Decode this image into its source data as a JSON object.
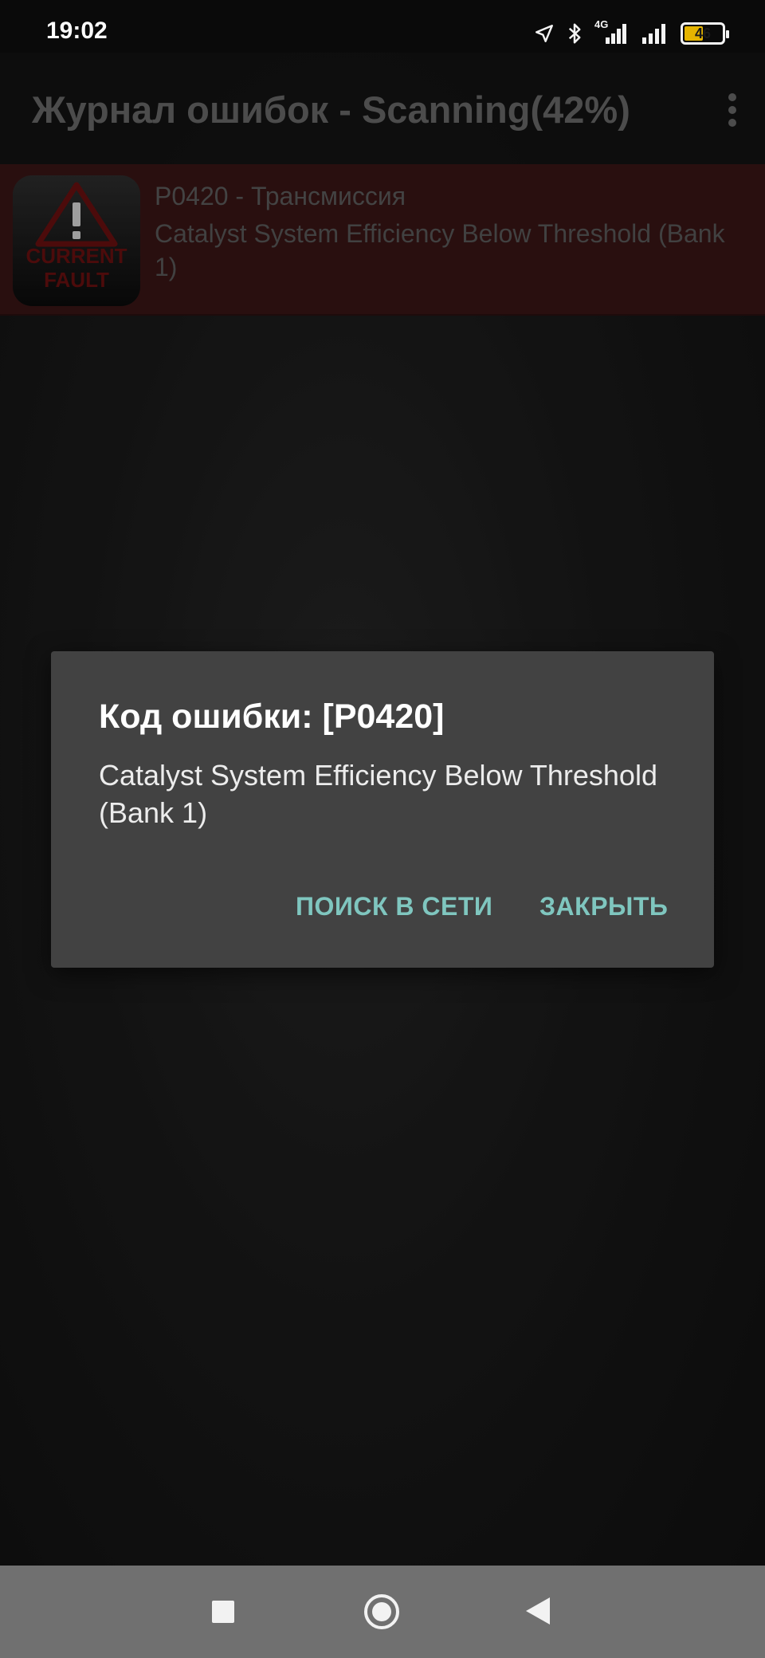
{
  "status_bar": {
    "time": "19:02",
    "network_label": "4G",
    "battery_level": "46",
    "icons": [
      "location-arrow-icon",
      "bluetooth-icon",
      "signal-4g-icon",
      "signal-icon",
      "battery-icon"
    ]
  },
  "app_bar": {
    "title": "Журнал ошибок - Scanning(42%)",
    "overflow_icon": "more-vert-icon"
  },
  "fault_list": [
    {
      "icon": "current-fault-icon",
      "icon_text": "CURRENT\nFAULT",
      "code": "P0420 - Трансмиссия",
      "description": "Catalyst System Efficiency Below Threshold (Bank 1)"
    }
  ],
  "dialog": {
    "title": "Код ошибки: [P0420]",
    "message": "Catalyst System Efficiency Below Threshold (Bank 1)",
    "buttons": {
      "search": "ПОИСК В СЕТИ",
      "close": "ЗАКРЫТЬ"
    }
  },
  "nav_bar": {
    "icons": [
      "recent-apps-icon",
      "home-icon",
      "back-icon"
    ]
  },
  "colors": {
    "accent": "#7fc6bf",
    "dialog_bg": "#424242",
    "fault_row_bg": "#3a1616",
    "battery": "#e5b400"
  }
}
